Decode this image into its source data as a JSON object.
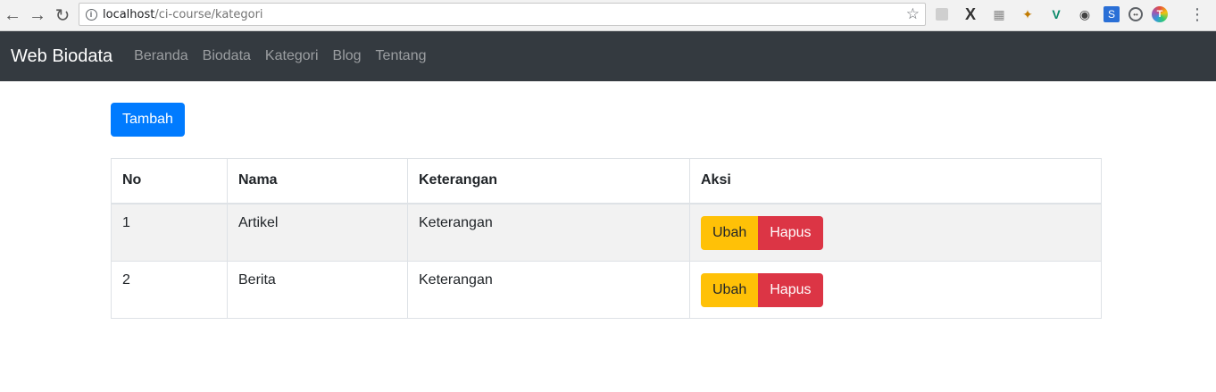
{
  "browser": {
    "url_host": "localhost",
    "url_path": "/ci-course/kategori"
  },
  "navbar": {
    "brand": "Web Biodata",
    "links": [
      "Beranda",
      "Biodata",
      "Kategori",
      "Blog",
      "Tentang"
    ]
  },
  "main": {
    "add_button": "Tambah",
    "table": {
      "headers": [
        "No",
        "Nama",
        "Keterangan",
        "Aksi"
      ],
      "rows": [
        {
          "no": "1",
          "nama": "Artikel",
          "keterangan": "Keterangan",
          "edit": "Ubah",
          "delete": "Hapus"
        },
        {
          "no": "2",
          "nama": "Berita",
          "keterangan": "Keterangan",
          "edit": "Ubah",
          "delete": "Hapus"
        }
      ]
    }
  },
  "colors": {
    "navbar_bg": "#343a40",
    "primary": "#007bff",
    "warning": "#ffc107",
    "danger": "#dc3545"
  }
}
